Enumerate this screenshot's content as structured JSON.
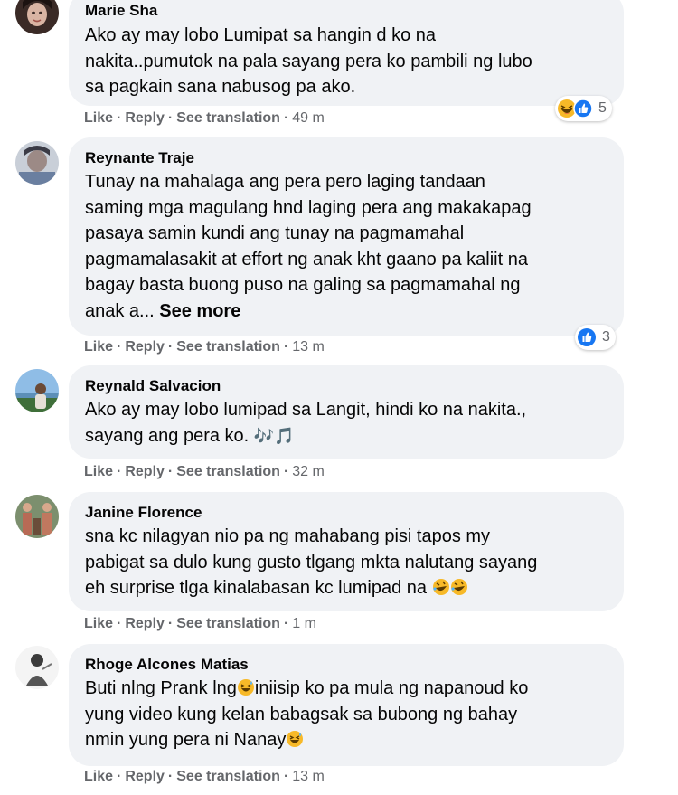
{
  "comments": [
    {
      "author": "Marie Sha",
      "lines": [
        "Ako ay may lobo Lumipat sa hangin d ko na",
        "nakita..pumutok na pala sayang pera ko pambili ng lubo",
        "sa pagkain sana nabusog pa ako."
      ],
      "actions": {
        "like": "Like",
        "reply": "Reply",
        "translate": "See translation",
        "time": "49 m"
      },
      "reactions": {
        "icons": [
          "haha-icon",
          "like-icon"
        ],
        "count": "5"
      }
    },
    {
      "author": "Reynante Traje",
      "lines": [
        "Tunay na mahalaga ang pera pero laging tandaan",
        "saming mga magulang hnd laging pera ang makakapag",
        "pasaya samin kundi ang tunay na pagmamahal",
        "pagmamalasakit at effort ng anak kht gaano pa kaliit na",
        "bagay basta buong puso na galing sa pagmamahal ng",
        "anak a..."
      ],
      "see_more": "See more",
      "actions": {
        "like": "Like",
        "reply": "Reply",
        "translate": "See translation",
        "time": "13 m"
      },
      "reactions": {
        "icons": [
          "like-icon"
        ],
        "count": "3"
      }
    },
    {
      "author": "Reynald Salvacion",
      "lines": [
        "Ako ay may lobo lumipad sa Langit, hindi ko na nakita.,",
        "sayang ang pera ko."
      ],
      "line_emoji": "🎶🎵",
      "actions": {
        "like": "Like",
        "reply": "Reply",
        "translate": "See translation",
        "time": "32 m"
      }
    },
    {
      "author": "Janine Florence",
      "lines": [
        "sna kc nilagyan nio pa ng mahabang pisi tapos my",
        "pabigat sa dulo kung gusto tlgang mkta nalutang sayang",
        "eh surprise tlga kinalabasan kc lumipad na"
      ],
      "actions": {
        "like": "Like",
        "reply": "Reply",
        "translate": "See translation",
        "time": "1 m"
      }
    },
    {
      "author": "Rhoge Alcones Matias",
      "lines_parts": [
        [
          "Buti nlng Prank lng",
          "iniisip ko pa mula ng napanoud ko"
        ],
        [
          "yung video kung kelan babagsak sa bubong ng bahay"
        ],
        [
          "nmin yung pera ni Nanay"
        ]
      ],
      "actions": {
        "like": "Like",
        "reply": "Reply",
        "translate": "See translation",
        "time": "13 m"
      }
    }
  ],
  "colors": {
    "bubble": "#f0f2f5",
    "text": "#050505",
    "meta": "#65676b",
    "like_blue": "#1877f2",
    "haha_yellow": "#f7b928"
  }
}
